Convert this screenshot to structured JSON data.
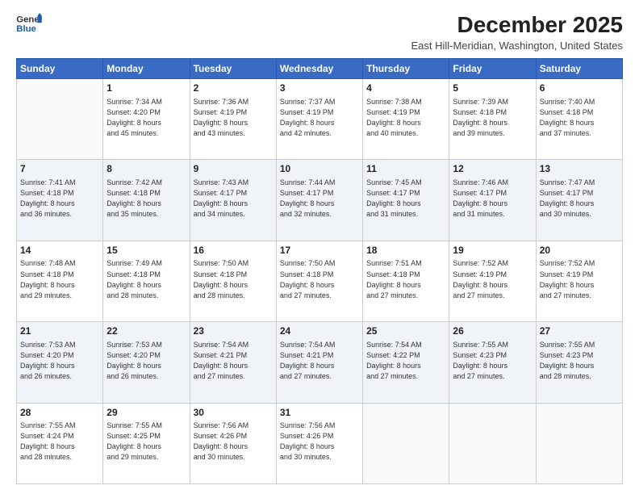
{
  "logo": {
    "line1": "General",
    "line2": "Blue"
  },
  "title": "December 2025",
  "subtitle": "East Hill-Meridian, Washington, United States",
  "headers": [
    "Sunday",
    "Monday",
    "Tuesday",
    "Wednesday",
    "Thursday",
    "Friday",
    "Saturday"
  ],
  "weeks": [
    [
      {
        "day": "",
        "info": ""
      },
      {
        "day": "1",
        "info": "Sunrise: 7:34 AM\nSunset: 4:20 PM\nDaylight: 8 hours\nand 45 minutes."
      },
      {
        "day": "2",
        "info": "Sunrise: 7:36 AM\nSunset: 4:19 PM\nDaylight: 8 hours\nand 43 minutes."
      },
      {
        "day": "3",
        "info": "Sunrise: 7:37 AM\nSunset: 4:19 PM\nDaylight: 8 hours\nand 42 minutes."
      },
      {
        "day": "4",
        "info": "Sunrise: 7:38 AM\nSunset: 4:19 PM\nDaylight: 8 hours\nand 40 minutes."
      },
      {
        "day": "5",
        "info": "Sunrise: 7:39 AM\nSunset: 4:18 PM\nDaylight: 8 hours\nand 39 minutes."
      },
      {
        "day": "6",
        "info": "Sunrise: 7:40 AM\nSunset: 4:18 PM\nDaylight: 8 hours\nand 37 minutes."
      }
    ],
    [
      {
        "day": "7",
        "info": "Sunrise: 7:41 AM\nSunset: 4:18 PM\nDaylight: 8 hours\nand 36 minutes."
      },
      {
        "day": "8",
        "info": "Sunrise: 7:42 AM\nSunset: 4:18 PM\nDaylight: 8 hours\nand 35 minutes."
      },
      {
        "day": "9",
        "info": "Sunrise: 7:43 AM\nSunset: 4:17 PM\nDaylight: 8 hours\nand 34 minutes."
      },
      {
        "day": "10",
        "info": "Sunrise: 7:44 AM\nSunset: 4:17 PM\nDaylight: 8 hours\nand 32 minutes."
      },
      {
        "day": "11",
        "info": "Sunrise: 7:45 AM\nSunset: 4:17 PM\nDaylight: 8 hours\nand 31 minutes."
      },
      {
        "day": "12",
        "info": "Sunrise: 7:46 AM\nSunset: 4:17 PM\nDaylight: 8 hours\nand 31 minutes."
      },
      {
        "day": "13",
        "info": "Sunrise: 7:47 AM\nSunset: 4:17 PM\nDaylight: 8 hours\nand 30 minutes."
      }
    ],
    [
      {
        "day": "14",
        "info": "Sunrise: 7:48 AM\nSunset: 4:18 PM\nDaylight: 8 hours\nand 29 minutes."
      },
      {
        "day": "15",
        "info": "Sunrise: 7:49 AM\nSunset: 4:18 PM\nDaylight: 8 hours\nand 28 minutes."
      },
      {
        "day": "16",
        "info": "Sunrise: 7:50 AM\nSunset: 4:18 PM\nDaylight: 8 hours\nand 28 minutes."
      },
      {
        "day": "17",
        "info": "Sunrise: 7:50 AM\nSunset: 4:18 PM\nDaylight: 8 hours\nand 27 minutes."
      },
      {
        "day": "18",
        "info": "Sunrise: 7:51 AM\nSunset: 4:18 PM\nDaylight: 8 hours\nand 27 minutes."
      },
      {
        "day": "19",
        "info": "Sunrise: 7:52 AM\nSunset: 4:19 PM\nDaylight: 8 hours\nand 27 minutes."
      },
      {
        "day": "20",
        "info": "Sunrise: 7:52 AM\nSunset: 4:19 PM\nDaylight: 8 hours\nand 27 minutes."
      }
    ],
    [
      {
        "day": "21",
        "info": "Sunrise: 7:53 AM\nSunset: 4:20 PM\nDaylight: 8 hours\nand 26 minutes."
      },
      {
        "day": "22",
        "info": "Sunrise: 7:53 AM\nSunset: 4:20 PM\nDaylight: 8 hours\nand 26 minutes."
      },
      {
        "day": "23",
        "info": "Sunrise: 7:54 AM\nSunset: 4:21 PM\nDaylight: 8 hours\nand 27 minutes."
      },
      {
        "day": "24",
        "info": "Sunrise: 7:54 AM\nSunset: 4:21 PM\nDaylight: 8 hours\nand 27 minutes."
      },
      {
        "day": "25",
        "info": "Sunrise: 7:54 AM\nSunset: 4:22 PM\nDaylight: 8 hours\nand 27 minutes."
      },
      {
        "day": "26",
        "info": "Sunrise: 7:55 AM\nSunset: 4:23 PM\nDaylight: 8 hours\nand 27 minutes."
      },
      {
        "day": "27",
        "info": "Sunrise: 7:55 AM\nSunset: 4:23 PM\nDaylight: 8 hours\nand 28 minutes."
      }
    ],
    [
      {
        "day": "28",
        "info": "Sunrise: 7:55 AM\nSunset: 4:24 PM\nDaylight: 8 hours\nand 28 minutes."
      },
      {
        "day": "29",
        "info": "Sunrise: 7:55 AM\nSunset: 4:25 PM\nDaylight: 8 hours\nand 29 minutes."
      },
      {
        "day": "30",
        "info": "Sunrise: 7:56 AM\nSunset: 4:26 PM\nDaylight: 8 hours\nand 30 minutes."
      },
      {
        "day": "31",
        "info": "Sunrise: 7:56 AM\nSunset: 4:26 PM\nDaylight: 8 hours\nand 30 minutes."
      },
      {
        "day": "",
        "info": ""
      },
      {
        "day": "",
        "info": ""
      },
      {
        "day": "",
        "info": ""
      }
    ]
  ]
}
